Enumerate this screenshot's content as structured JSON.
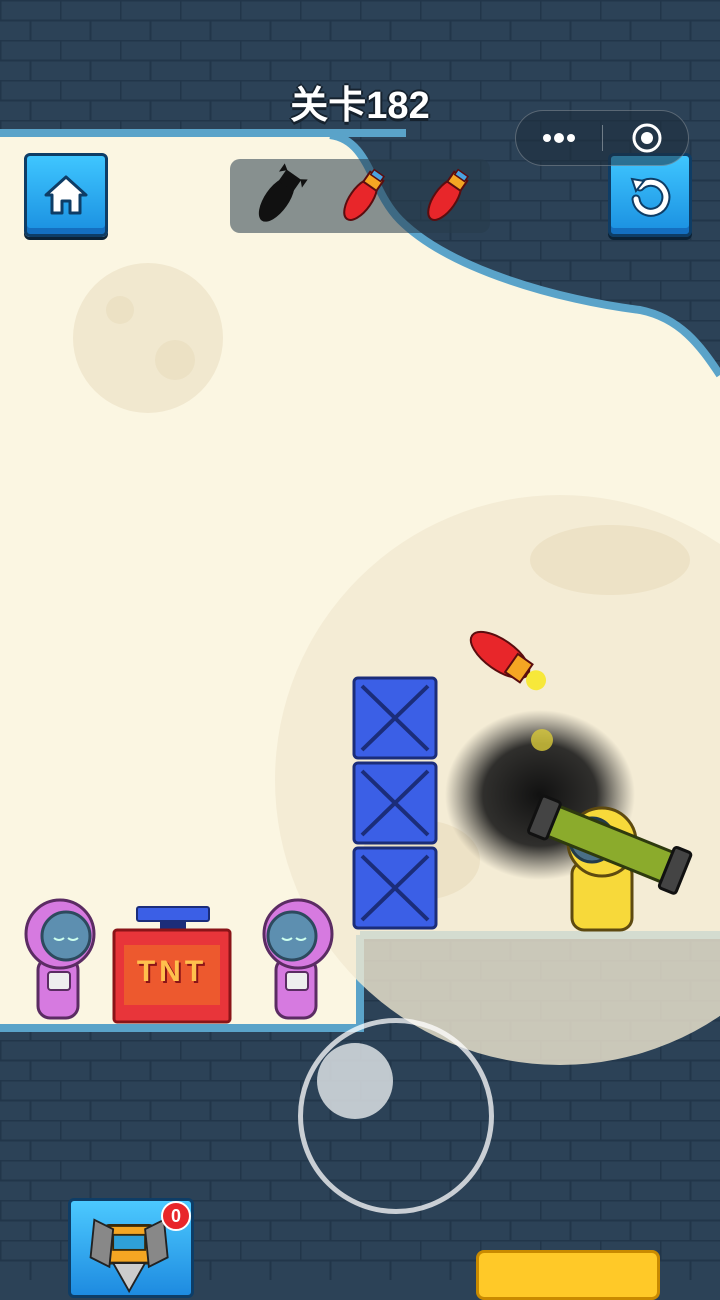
{
  "level": {
    "title": "关卡182"
  },
  "toolbar": {
    "home_icon": "home-icon",
    "restart_icon": "restart-icon"
  },
  "ammo": {
    "total": 3,
    "used": 1,
    "slots": [
      {
        "state": "used",
        "icon": "rocket-silhouette-icon"
      },
      {
        "state": "available",
        "icon": "rocket-icon"
      },
      {
        "state": "available",
        "icon": "rocket-icon"
      }
    ]
  },
  "miniprogram_capsule": {
    "more_icon": "more-dots-icon",
    "close_icon": "target-close-icon"
  },
  "scene": {
    "objects": [
      "pink-astronaut",
      "tnt-crate",
      "pink-astronaut",
      "blue-crate-stack",
      "yellow-astronaut-with-bazooka",
      "rocket-in-flight",
      "smoke-cloud"
    ],
    "tnt_label": "TNT"
  },
  "powerup": {
    "count": "0",
    "icon": "drill-robot-icon"
  },
  "colors": {
    "wall": "#2c4257",
    "sky": "#fbf6e2",
    "button_blue": "#2ab0f5",
    "crate_blue": "#3b5fe6",
    "tnt_red": "#e8353a",
    "astronaut_pink": "#d67ae0",
    "astronaut_yellow": "#f7d93a",
    "skip_yellow": "#ffc928"
  }
}
